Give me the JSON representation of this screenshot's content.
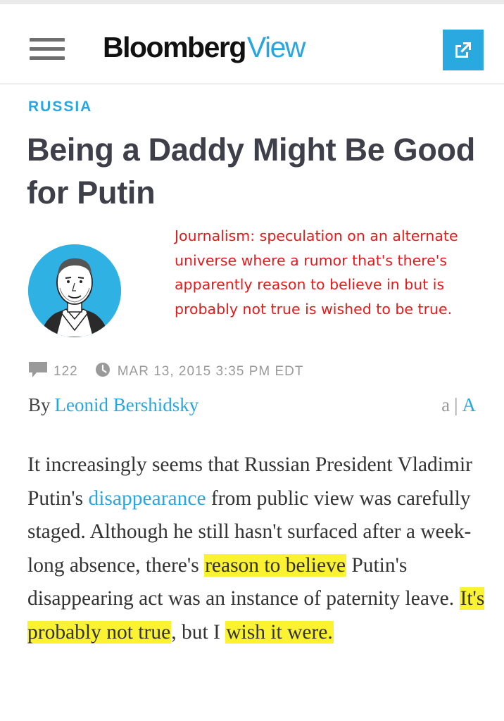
{
  "header": {
    "logo_bold": "Bloomberg",
    "logo_light": "View"
  },
  "article": {
    "section": "RUSSIA",
    "headline": "Being a Daddy Might Be Good for Putin",
    "comment_count": "122",
    "timestamp": "MAR 13, 2015 3:35 PM EDT",
    "byline_prefix": "By",
    "author": "Leonid Bershidsky",
    "textsize_small": "a",
    "textsize_sep": "|",
    "textsize_large": "A",
    "body": {
      "p1": "It increasingly seems that Russian President Vladimir Putin's ",
      "link1": "disappearance",
      "p2": " from public view was carefully staged. Although he still hasn't surfaced after a week-long absence, there's ",
      "hl1": "reason to believe",
      "p3": " Putin's disappearing act was an instance of paternity leave. ",
      "hl2": "It's probably not true",
      "p4": ", but I ",
      "hl3": "wish it were."
    }
  },
  "annotation": {
    "text": "Journalism: speculation on an alternate universe where a rumor that's there's apparently reason to believe in but is probably not true is wished to be true."
  },
  "colors": {
    "accent": "#2aa6de",
    "headline": "#3f3f4a",
    "annotation": "#e51b1b",
    "highlight": "#fbf231"
  },
  "icons": {
    "menu": "hamburger-icon",
    "share": "external-link-icon",
    "comments": "speech-bubble-icon",
    "time": "clock-icon"
  }
}
